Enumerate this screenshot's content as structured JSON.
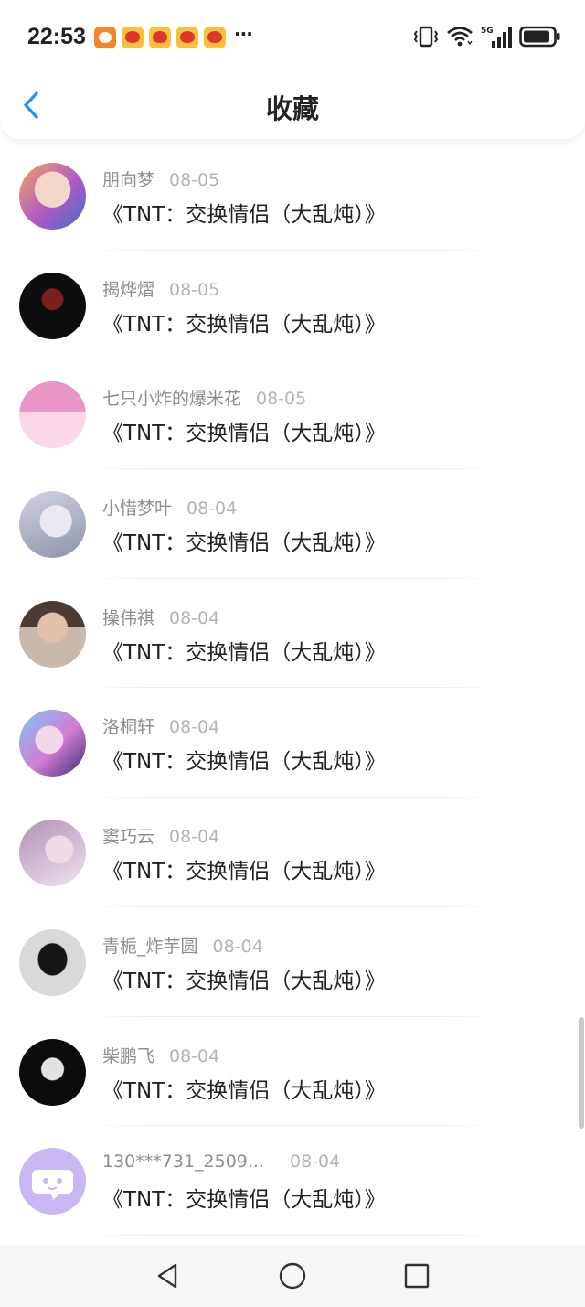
{
  "status_bar": {
    "time": "22:53",
    "notification_icons": [
      "app-icon",
      "weibo-icon",
      "weibo-icon",
      "weibo-icon",
      "weibo-icon"
    ],
    "more_indicator": "···",
    "network_label": "5G"
  },
  "header": {
    "back_icon": "chevron-left-icon",
    "title": "收藏",
    "accent_color": "#2196f3"
  },
  "items": [
    {
      "user": "朋向梦",
      "date": "08-05",
      "title": "《TNT：交换情侣（大乱炖）》"
    },
    {
      "user": "揭烨熠",
      "date": "08-05",
      "title": "《TNT：交换情侣（大乱炖）》"
    },
    {
      "user": "七只小炸的爆米花",
      "date": "08-05",
      "title": "《TNT：交换情侣（大乱炖）》"
    },
    {
      "user": "小惜梦叶",
      "date": "08-04",
      "title": "《TNT：交换情侣（大乱炖）》"
    },
    {
      "user": "操伟祺",
      "date": "08-04",
      "title": "《TNT：交换情侣（大乱炖）》"
    },
    {
      "user": "洛桐轩",
      "date": "08-04",
      "title": "《TNT：交换情侣（大乱炖）》"
    },
    {
      "user": "窦巧云",
      "date": "08-04",
      "title": "《TNT：交换情侣（大乱炖）》"
    },
    {
      "user": "青栀_炸芋圆",
      "date": "08-04",
      "title": "《TNT：交换情侣（大乱炖）》"
    },
    {
      "user": "柴鹏飞",
      "date": "08-04",
      "title": "《TNT：交换情侣（大乱炖）》"
    },
    {
      "user": "130***731_2509...",
      "date": "08-04",
      "title": "《TNT：交换情侣（大乱炖）》"
    }
  ],
  "bottom_nav": {
    "buttons": [
      "back-triangle-icon",
      "home-circle-icon",
      "recent-square-icon"
    ]
  }
}
